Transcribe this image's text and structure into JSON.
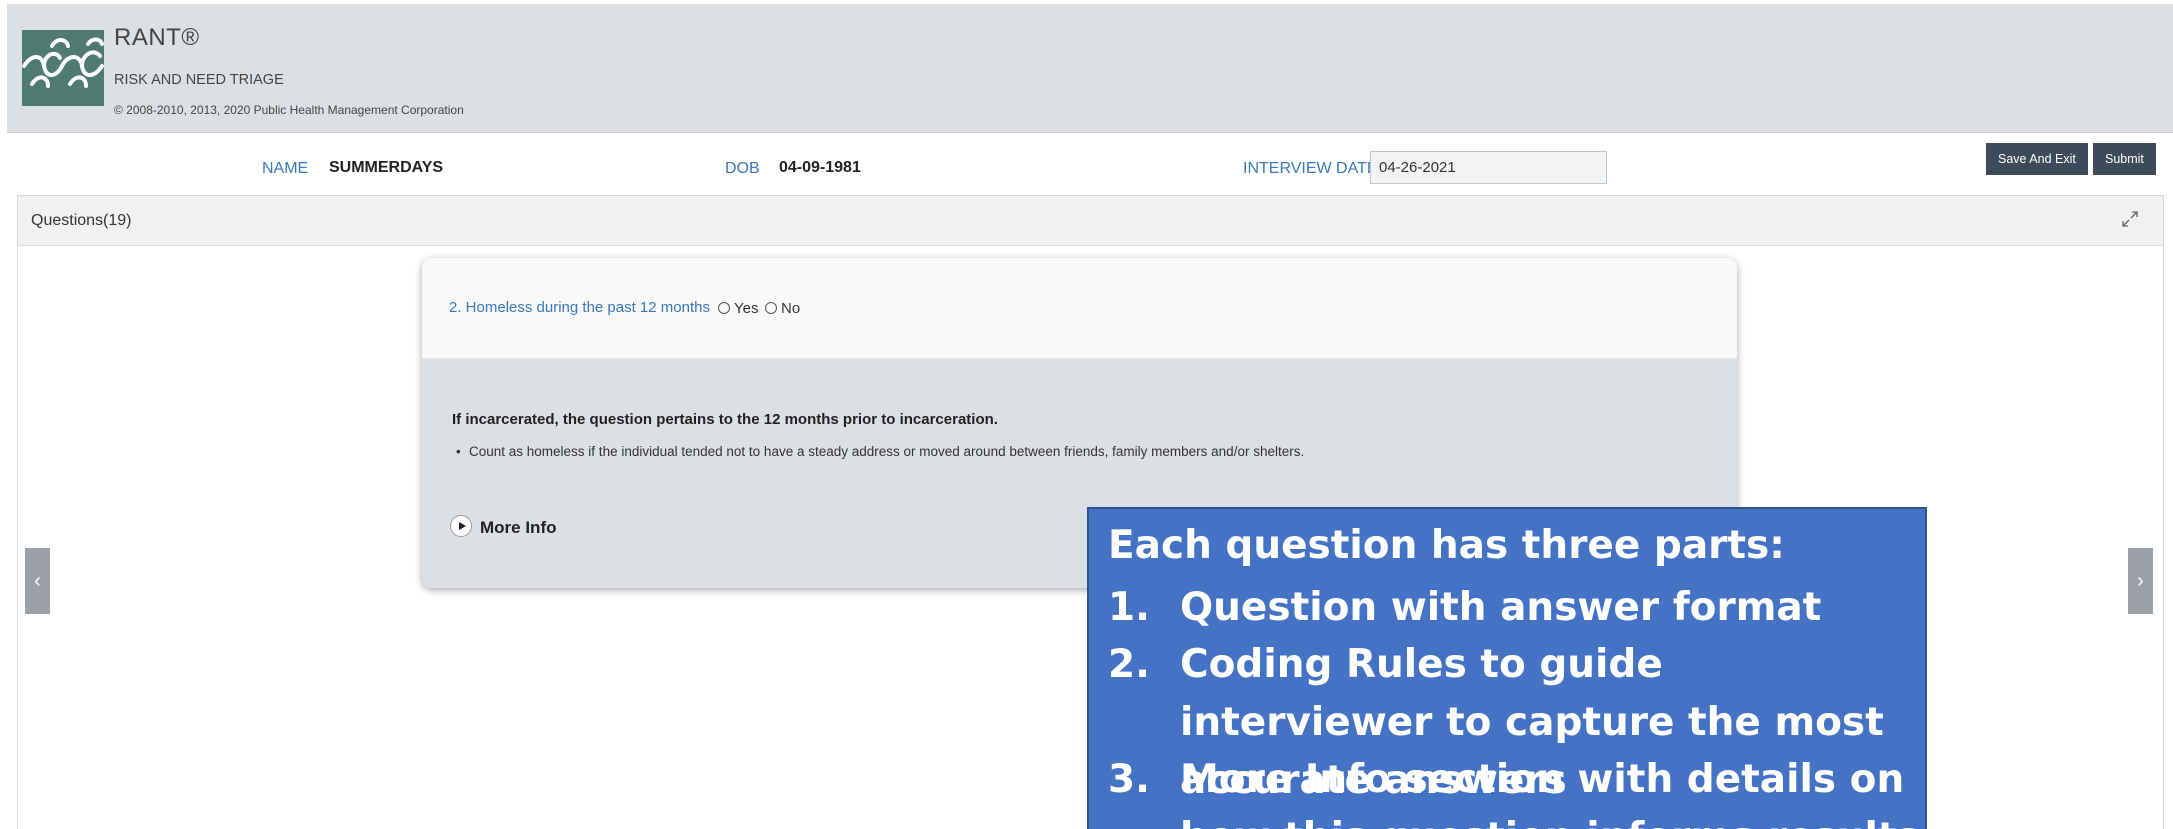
{
  "app": {
    "title": "RANT®",
    "subtitle": "RISK AND NEED TRIAGE",
    "copyright": "© 2008-2010, 2013, 2020 Public Health Management Corporation"
  },
  "infobar": {
    "name_label": "NAME",
    "name_value": "SUMMERDAYS",
    "dob_label": "DOB",
    "dob_value": "04-09-1981",
    "interview_label": "INTERVIEW DATE",
    "interview_value": "04-26-2021",
    "save_exit_label": "Save And Exit",
    "submit_label": "Submit"
  },
  "panel": {
    "title": "Questions(19)"
  },
  "question": {
    "text": "2. Homeless during the past 12 months",
    "options": [
      "Yes",
      "No"
    ],
    "rule_title": "If incarcerated, the question pertains to the 12 months prior to incarceration.",
    "rule_bullet": "Count as homeless if the individual tended not to have a steady address or moved around between friends, family members and/or shelters.",
    "more_info_label": "More Info"
  },
  "nav": {
    "prev": "‹",
    "next": "›"
  },
  "callout": {
    "title": "Each question has three parts:",
    "items": [
      {
        "num": "1.",
        "text": "Question with answer format"
      },
      {
        "num": "2.",
        "text": "Coding Rules to guide interviewer to capture the most accurate answers"
      },
      {
        "num": "3.",
        "text": "More Info section with details on how this question informs results"
      }
    ]
  },
  "colors": {
    "header_bg": "#dde0e3",
    "accent_blue": "#3a78b8",
    "button_bg": "#3d4a59",
    "callout_bg": "#4472c4",
    "logo_bg": "#4e7a72"
  },
  "icons": [
    "rant-logo",
    "expand-icon",
    "radio-icon",
    "play-icon",
    "chevron-left-icon",
    "chevron-right-icon"
  ]
}
